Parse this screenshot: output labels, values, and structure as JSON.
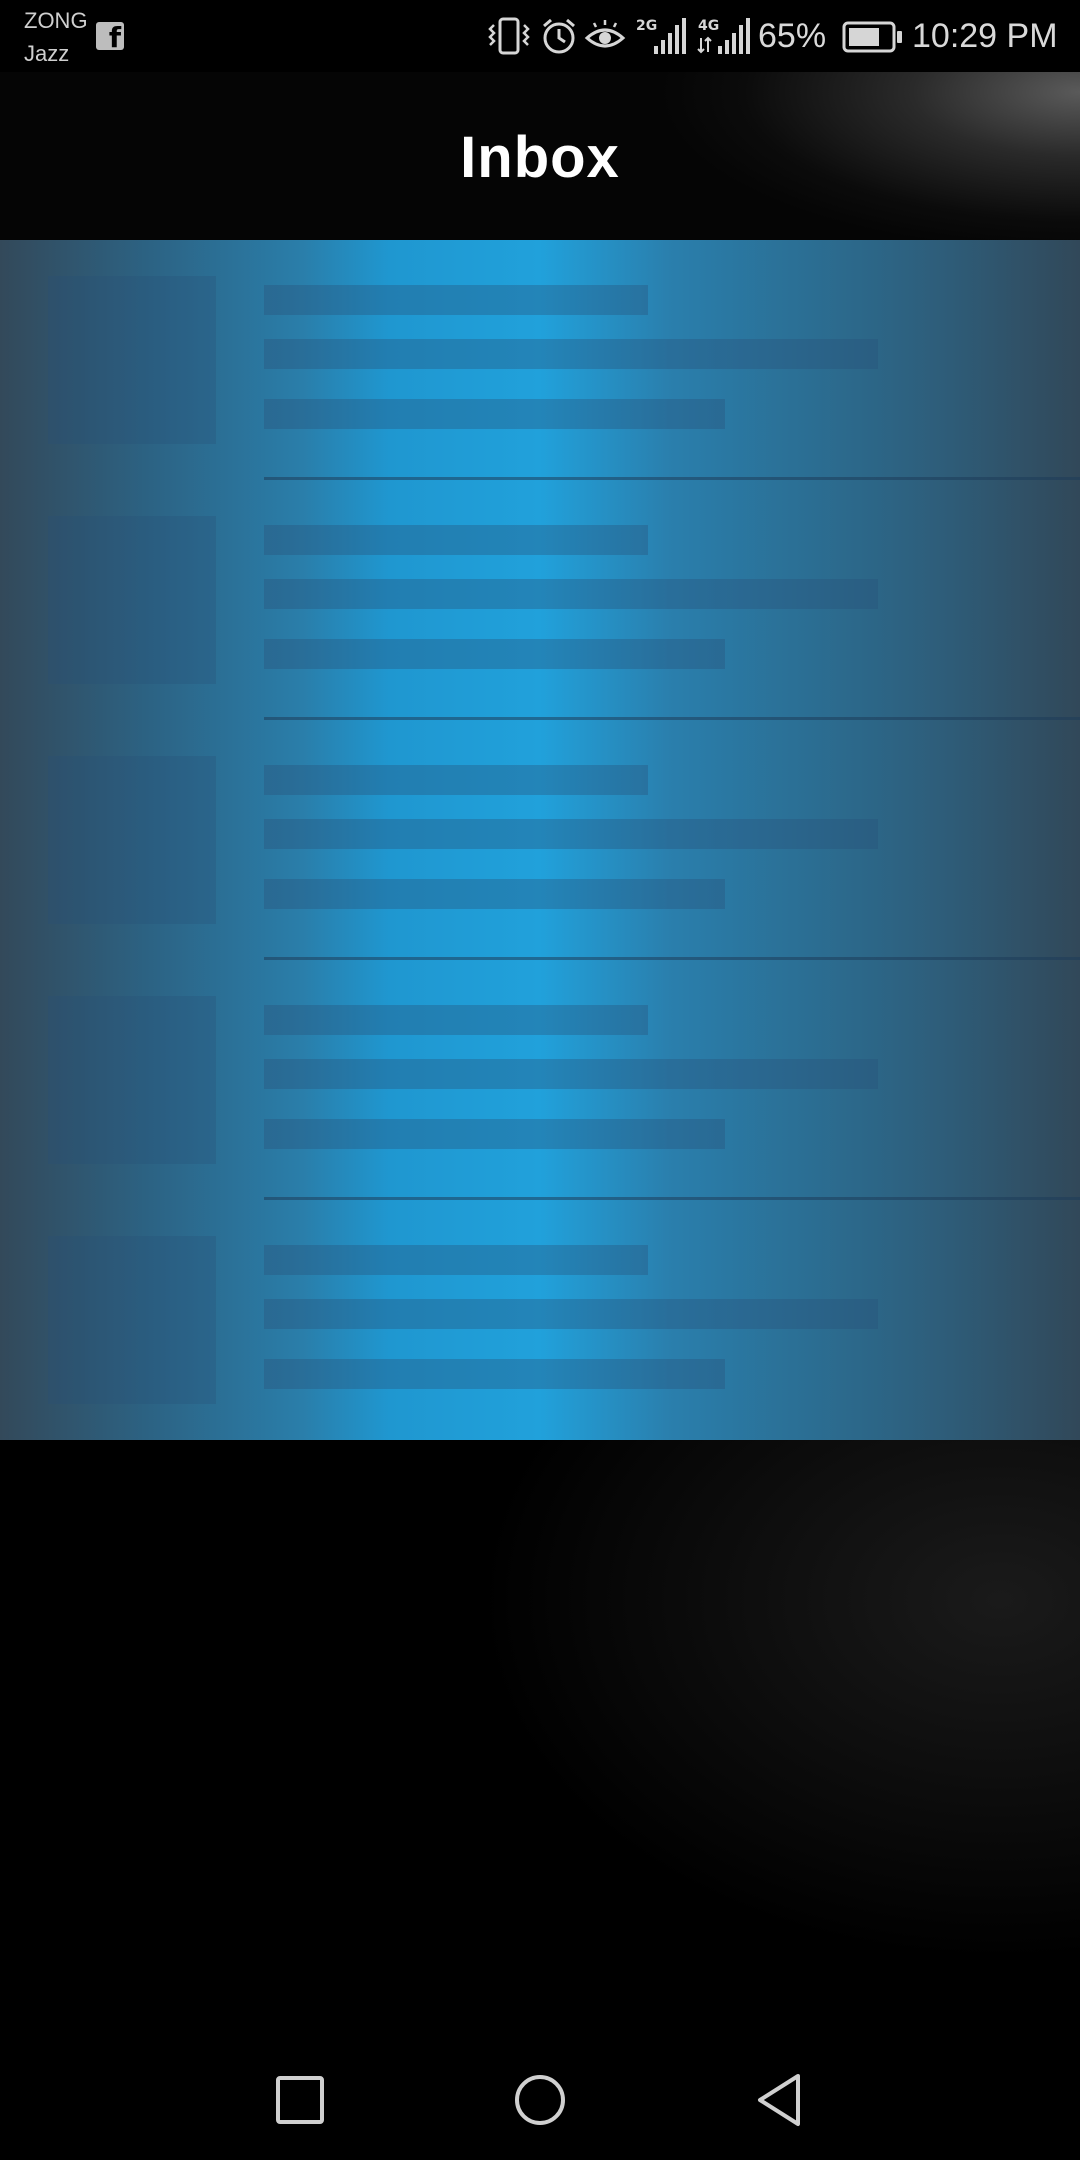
{
  "status_bar": {
    "carrier_primary": "ZONG",
    "carrier_secondary": "Jazz",
    "network_1": "2G",
    "network_2": "4G",
    "battery_percent": "65%",
    "time": "10:29 PM",
    "icons": [
      "facebook-icon",
      "vibrate-icon",
      "alarm-icon",
      "eye-comfort-icon",
      "signal-icon",
      "battery-icon"
    ]
  },
  "header": {
    "title": "Inbox"
  },
  "inbox": {
    "state": "loading",
    "placeholder_rows": 5
  },
  "nav_bar": {
    "icons": [
      "recents-icon",
      "home-icon",
      "back-icon"
    ]
  },
  "colors": {
    "shimmer_center": "#21a1db",
    "shimmer_edge": "#314859",
    "background": "#000000",
    "title": "#ffffff"
  }
}
